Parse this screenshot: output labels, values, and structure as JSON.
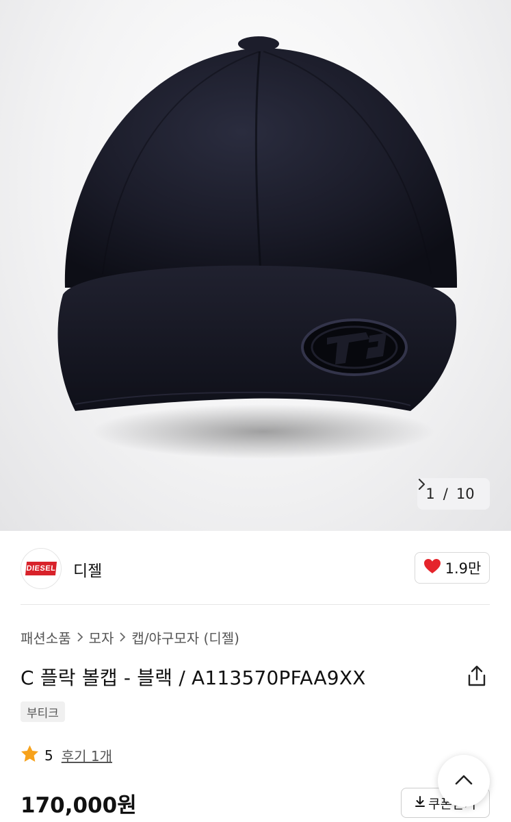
{
  "gallery": {
    "current": "1",
    "separator": "/",
    "total": "10",
    "next_icon": "chevron-right-icon"
  },
  "brand": {
    "logo_text": "DIESEL",
    "name": "디젤",
    "logo_color": "#d8222a"
  },
  "like": {
    "icon": "heart-icon",
    "count": "1.9만",
    "color": "#e5242b"
  },
  "breadcrumb": [
    "패션소품",
    "모자",
    "캡/야구모자 (디젤)"
  ],
  "product": {
    "title": "C 플락 볼캡 - 블랙 / A113570PFAA9XX",
    "tag": "부티크",
    "rating": "5",
    "reviews_label": "후기 1개",
    "price": "170,000원"
  },
  "actions": {
    "share_icon": "share-icon",
    "coupon_label": "쿠폰받기",
    "coupon_icon": "download-icon",
    "scroll_top_icon": "chevron-up-icon"
  },
  "colors": {
    "star": "#f7a21b",
    "text": "#111111"
  }
}
